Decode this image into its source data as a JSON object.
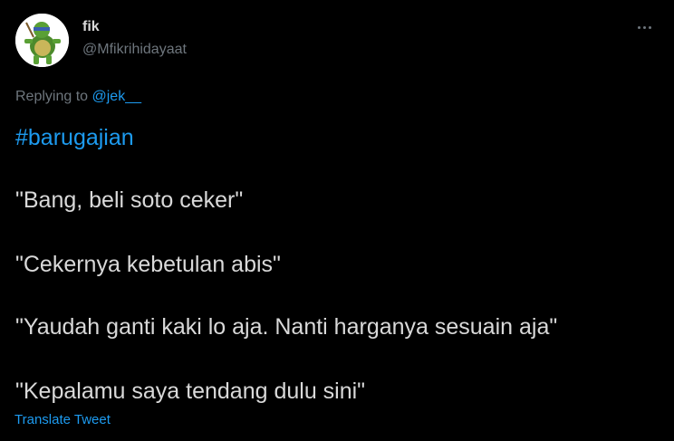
{
  "tweet": {
    "display_name": "fik",
    "handle": "@Mfikrihidayaat",
    "replying_prefix": "Replying to",
    "replying_to": "@jek__",
    "hashtag": "#barugajian",
    "lines": [
      "\"Bang, beli soto ceker\"",
      "\"Cekernya kebetulan abis\"",
      "\"Yaudah ganti kaki lo aja. Nanti harganya sesuain aja\"",
      "\"Kepalamu saya tendang dulu sini\""
    ],
    "translate_label": "Translate Tweet",
    "more_icon": "more-horizontal-icon",
    "avatar_icon": "turtle-avatar"
  },
  "colors": {
    "background": "#000000",
    "text": "#d9d9d9",
    "secondary": "#6e767d",
    "accent": "#1d9bf0"
  }
}
